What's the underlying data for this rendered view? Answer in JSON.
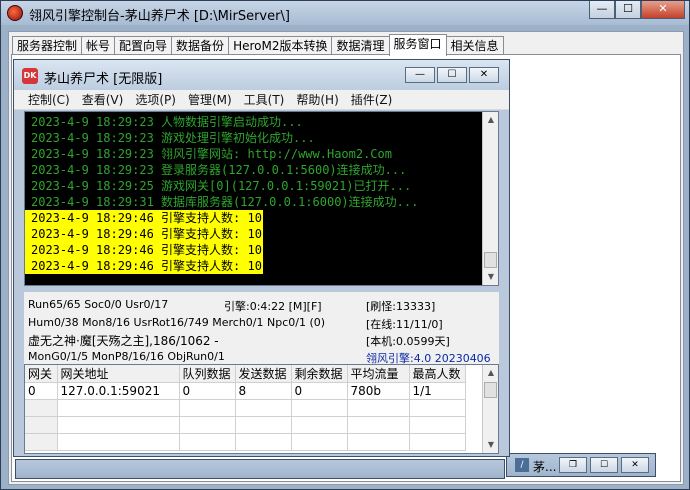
{
  "outer": {
    "title": "翎风引擎控制台-茅山养尸术 [D:\\MirServer\\]",
    "caption": {
      "minimize": "—",
      "maximize": "☐",
      "close": "✕"
    }
  },
  "tabs": [
    {
      "label": "服务器控制"
    },
    {
      "label": "帐号"
    },
    {
      "label": "配置向导"
    },
    {
      "label": "数据备份"
    },
    {
      "label": "HeroM2版本转换"
    },
    {
      "label": "数据清理"
    },
    {
      "label": "服务窗口"
    },
    {
      "label": "相关信息"
    }
  ],
  "inner": {
    "icon_text": "DK",
    "title": "茅山养尸术 [无限版]",
    "caption": {
      "minimize": "—",
      "maximize": "☐",
      "close": "✕"
    },
    "menu": [
      "控制(C)",
      "查看(V)",
      "选项(P)",
      "管理(M)",
      "工具(T)",
      "帮助(H)",
      "插件(Z)"
    ]
  },
  "log": [
    {
      "text": "2023-4-9 18:29:23 人物数据引擎启动成功...",
      "highlight": false
    },
    {
      "text": "2023-4-9 18:29:23 游戏处理引擎初始化成功...",
      "highlight": false
    },
    {
      "text": "2023-4-9 18:29:23 翎风引擎网站: http://www.Haom2.Com",
      "highlight": false
    },
    {
      "text": "2023-4-9 18:29:23 登录服务器(127.0.0.1:5600)连接成功...",
      "highlight": false
    },
    {
      "text": "2023-4-9 18:29:25 游戏网关[0](127.0.0.1:59021)已打开...",
      "highlight": false
    },
    {
      "text": "2023-4-9 18:29:31 数据库服务器(127.0.0.1:6000)连接成功...",
      "highlight": false
    },
    {
      "text": "2023-4-9 18:29:46 引擎支持人数: 10",
      "highlight": true
    },
    {
      "text": "2023-4-9 18:29:46 引擎支持人数: 10",
      "highlight": true
    },
    {
      "text": "2023-4-9 18:29:46 引擎支持人数: 10",
      "highlight": true
    },
    {
      "text": "2023-4-9 18:29:46 引擎支持人数: 10",
      "highlight": true
    }
  ],
  "stats": {
    "run": "Run65/65 Soc0/0 Usr0/17",
    "engine_time": "引擎:0:4:22 [M][F]",
    "brush": "[刷怪:13333]",
    "hum": "Hum0/38 Mon8/16 UsrRot16/749 Merch0/1 Npc0/1 (0)",
    "online": "[在线:11/11/0]",
    "boss": "虚无之神·魔[天殇之主],186/1062 -",
    "local": "[本机:0.0599天]",
    "mon": "MonG0/1/5 MonP8/16/16 ObjRun0/1",
    "version": "翎风引擎:4.0 20230406"
  },
  "grid": {
    "headers": [
      "网关",
      "网关地址",
      "队列数据",
      "发送数据",
      "剩余数据",
      "平均流量",
      "最高人数"
    ],
    "rows": [
      [
        "0",
        "127.0.0.1:59021",
        "0",
        "8",
        "0",
        "780b",
        "1/1"
      ]
    ]
  },
  "minbars": [
    {
      "label": "茅..."
    }
  ],
  "colors": {
    "log_text": "#2ea52e",
    "highlight_bg": "#ffff00",
    "version_text": "#0a2aa6"
  }
}
